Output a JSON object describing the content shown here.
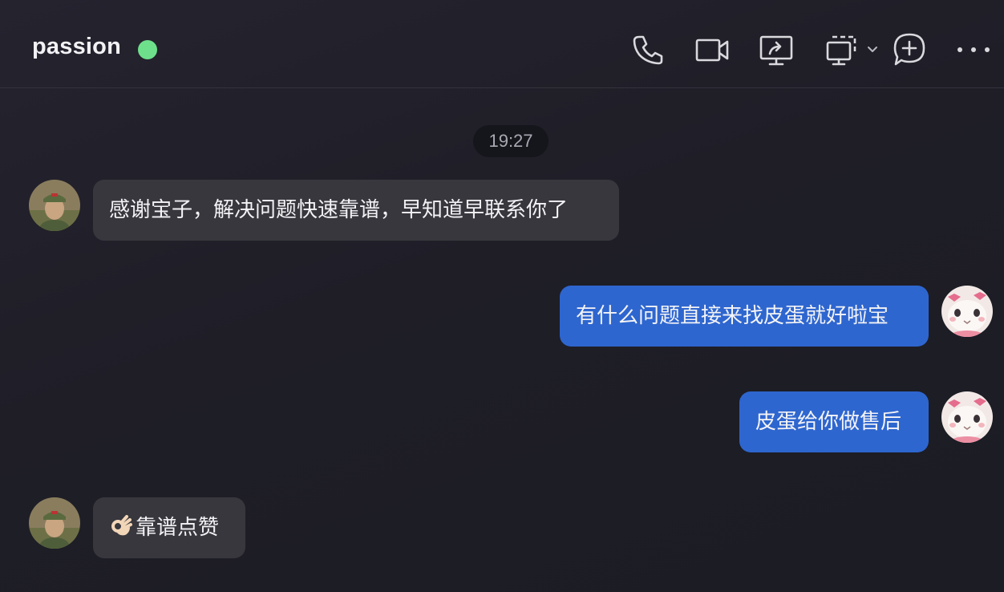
{
  "header": {
    "title": "passion",
    "status_color": "#6ee08b",
    "tools": [
      {
        "name": "phone-icon"
      },
      {
        "name": "video-camera-icon"
      },
      {
        "name": "screen-share-icon"
      },
      {
        "name": "multi-screen-icon"
      },
      {
        "name": "add-chat-icon"
      },
      {
        "name": "more-icon"
      }
    ]
  },
  "timestamp": "19:27",
  "messages": [
    {
      "direction": "incoming",
      "sender_avatar": "soldier-avatar",
      "text": "感谢宝子，解决问题快速靠谱，早知道早联系你了"
    },
    {
      "direction": "outgoing",
      "sender_avatar": "hamster-avatar",
      "text": "有什么问题直接来找皮蛋就好啦宝"
    },
    {
      "direction": "outgoing",
      "sender_avatar": "hamster-avatar",
      "text": "皮蛋给你做售后"
    },
    {
      "direction": "incoming",
      "sender_avatar": "soldier-avatar",
      "emoji": "ok-hand-emoji",
      "text": "靠谱点赞"
    }
  ],
  "colors": {
    "incoming_bubble": "#37373d",
    "outgoing_bubble": "#2e66cf",
    "background": "#1f1e27"
  }
}
